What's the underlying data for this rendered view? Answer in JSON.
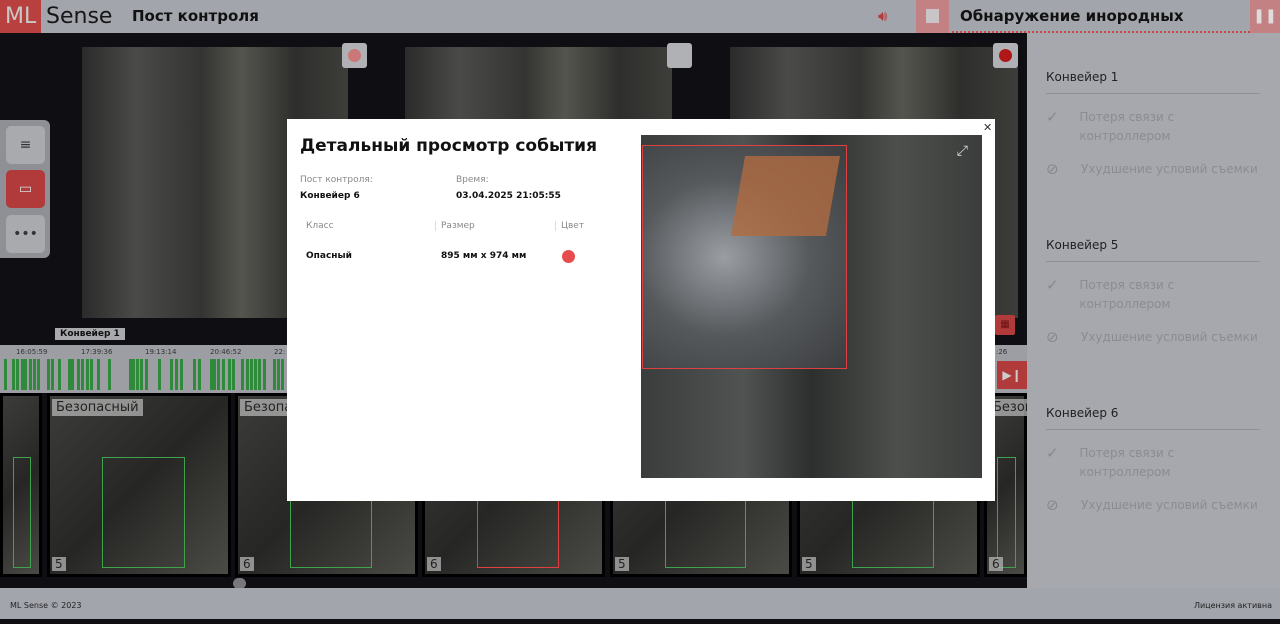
{
  "header": {
    "logo_ml": "ML",
    "logo_sense": "Sense",
    "title": "Пост контроля",
    "detection_title": "Обнаружение инородных объектов"
  },
  "colors": {
    "accent": "#d04040",
    "bbox_danger": "#e04040",
    "bbox_safe": "#3fa34d",
    "timeline_event": "#2f8a3c"
  },
  "cameras": [
    {
      "indicator": "record"
    },
    {
      "indicator": "stop"
    },
    {
      "indicator": "record"
    }
  ],
  "conveyor_label": "Конвейер 1",
  "timeline": {
    "ticks": [
      "16:05:59",
      "17:39:36",
      "19:13:14",
      "20:46:52",
      "22:"
    ],
    "end_tick": ":26"
  },
  "thumbnails": [
    {
      "label": "",
      "num": ""
    },
    {
      "label": "Безопасный",
      "num": "5"
    },
    {
      "label": "Безопа",
      "num": "6"
    },
    {
      "label": "",
      "num": "6"
    },
    {
      "label": "",
      "num": "5"
    },
    {
      "label": "",
      "num": "5"
    },
    {
      "label": "Безоп",
      "num": "6"
    }
  ],
  "sidebar": {
    "sections": [
      {
        "title": "Конвейер 1",
        "items": [
          "Потеря связи с контроллером",
          "Ухудшение условий съемки"
        ]
      },
      {
        "title": "Конвейер 5",
        "items": [
          "Потеря связи с контроллером",
          "Ухудшение условий съемки"
        ]
      },
      {
        "title": "Конвейер 6",
        "items": [
          "Потеря связи с контроллером",
          "Ухудшение условий съемки"
        ]
      }
    ]
  },
  "modal": {
    "title": "Детальный просмотр события",
    "post_label": "Пост контроля:",
    "post_value": "Конвейер 6",
    "time_label": "Время:",
    "time_value": "03.04.2025 21:05:55",
    "columns": [
      "Класс",
      "Размер",
      "Цвет"
    ],
    "row": {
      "class": "Опасный",
      "size": "895 мм x 974 мм",
      "color": "#e74c4c"
    }
  },
  "footer": {
    "copyright": "ML Sense © 2023",
    "license": "Лицензия активна"
  }
}
